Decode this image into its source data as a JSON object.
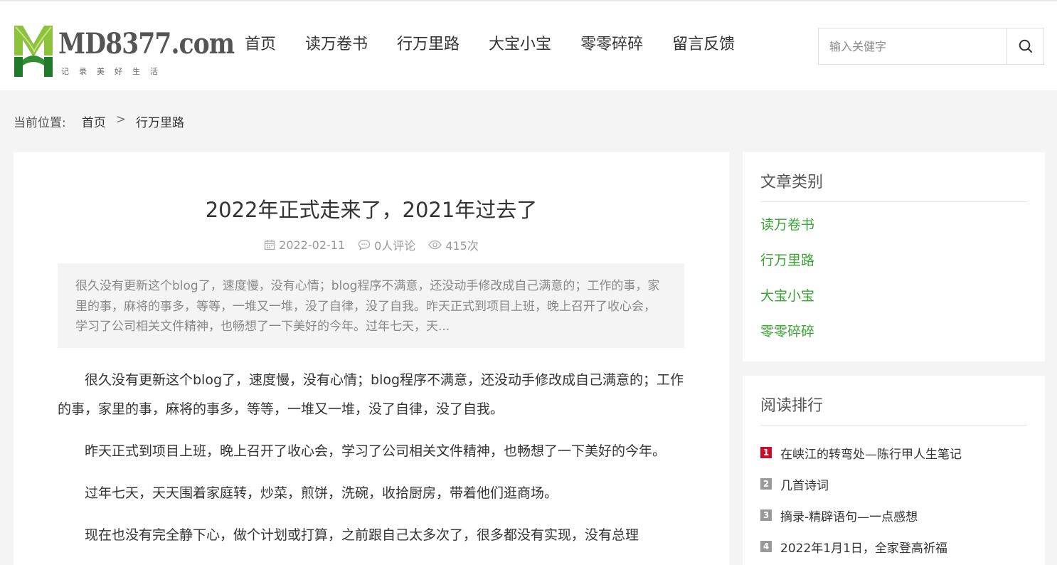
{
  "logo": {
    "text": "MD8377.com",
    "slogan": "记录美好生活",
    "colors": {
      "green_dark": "#1e7a2a",
      "green_light": "#8dc23c"
    }
  },
  "nav": {
    "items": [
      "首页",
      "读万卷书",
      "行万里路",
      "大宝小宝",
      "零零碎碎",
      "留言反馈"
    ]
  },
  "search": {
    "placeholder": "输入关健字",
    "icon": "search-icon"
  },
  "breadcrumb": {
    "label": "当前位置:",
    "home": "首页",
    "sep": ">",
    "current": "行万里路"
  },
  "article": {
    "title": "2022年正式走来了，2021年过去了",
    "date": "2022-02-11",
    "comments": "0人评论",
    "views": "415次",
    "summary": "很久没有更新这个blog了，速度慢，没有心情；blog程序不满意，还没动手修改成自己满意的；工作的事，家里的事，麻将的事多，等等，一堆又一堆，没了自律，没了自我。昨天正式到项目上班，晚上召开了收心会，学习了公司相关文件精神，也畅想了一下美好的今年。过年七天，天...",
    "paragraphs": [
      "很久没有更新这个blog了，速度慢，没有心情；blog程序不满意，还没动手修改成自己满意的；工作的事，家里的事，麻将的事多，等等，一堆又一堆，没了自律，没了自我。",
      "昨天正式到项目上班，晚上召开了收心会，学习了公司相关文件精神，也畅想了一下美好的今年。",
      "过年七天，天天围着家庭转，炒菜，煎饼，洗碗，收拾厨房，带着他们逛商场。",
      "现在也没有完全静下心，做个计划或打算，之前跟自己太多次了，很多都没有实现，没有总理"
    ]
  },
  "sidebar": {
    "categories": {
      "title": "文章类别",
      "items": [
        "读万卷书",
        "行万里路",
        "大宝小宝",
        "零零碎碎"
      ],
      "link_color": "#3aa535"
    },
    "ranking": {
      "title": "阅读排行",
      "items": [
        {
          "num": "1",
          "text": "在峡江的转弯处—陈行甲人生笔记"
        },
        {
          "num": "2",
          "text": "几首诗词"
        },
        {
          "num": "3",
          "text": "摘录-精辟语句—一点感想"
        },
        {
          "num": "4",
          "text": "2022年1月1日，全家登高祈福"
        }
      ],
      "first_color": "#c8102e"
    }
  }
}
